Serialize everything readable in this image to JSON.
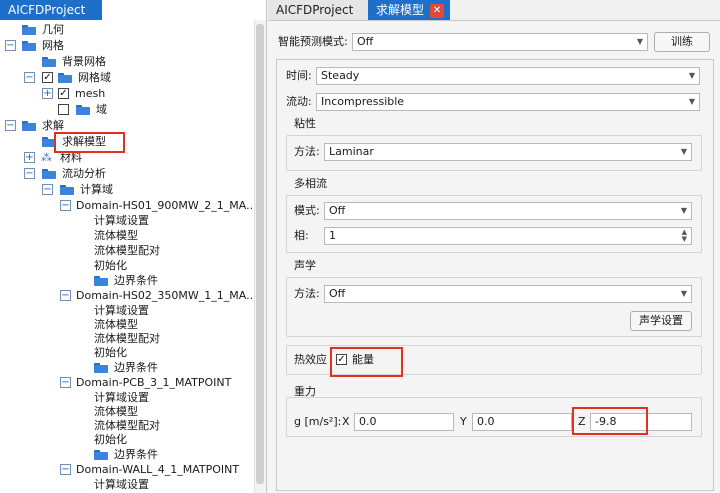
{
  "left_tab": {
    "label": "AICFDProject"
  },
  "tree": {
    "items": [
      {
        "label": "几何"
      },
      {
        "label": "网格"
      },
      {
        "label": "背景网格"
      },
      {
        "label": "网格域"
      },
      {
        "label": "mesh"
      },
      {
        "label": "域"
      },
      {
        "label": "求解"
      },
      {
        "label": "求解模型"
      },
      {
        "label": "材料"
      },
      {
        "label": "流动分析"
      },
      {
        "label": "计算域"
      },
      {
        "label": "Domain-HS01_900MW_2_1_MA..."
      },
      {
        "label": "计算域设置"
      },
      {
        "label": "流体模型"
      },
      {
        "label": "流体模型配对"
      },
      {
        "label": "初始化"
      },
      {
        "label": "边界条件"
      },
      {
        "label": "Domain-HS02_350MW_1_1_MA..."
      },
      {
        "label": "计算域设置"
      },
      {
        "label": "流体模型"
      },
      {
        "label": "流体模型配对"
      },
      {
        "label": "初始化"
      },
      {
        "label": "边界条件"
      },
      {
        "label": "Domain-PCB_3_1_MATPOINT"
      },
      {
        "label": "计算域设置"
      },
      {
        "label": "流体模型"
      },
      {
        "label": "流体模型配对"
      },
      {
        "label": "初始化"
      },
      {
        "label": "边界条件"
      },
      {
        "label": "Domain-WALL_4_1_MATPOINT"
      },
      {
        "label": "计算域设置"
      }
    ]
  },
  "right_tabs": [
    {
      "label": "AICFDProject"
    },
    {
      "label": "求解模型",
      "close": "✕"
    }
  ],
  "form": {
    "smart_mode": {
      "label": "智能预测模式:",
      "value": "Off"
    },
    "train_button": "训练",
    "time": {
      "label": "时间:",
      "value": "Steady"
    },
    "flow": {
      "label": "流动:",
      "value": "Incompressible"
    },
    "viscosity": {
      "title": "粘性",
      "method_label": "方法:",
      "method_value": "Laminar"
    },
    "multiphase": {
      "title": "多相流",
      "model_label": "模式:",
      "model_value": "Off",
      "phase_label": "相:",
      "phase_value": "1"
    },
    "acoustics": {
      "title": "声学",
      "method_label": "方法:",
      "method_value": "Off",
      "settings_button": "声学设置"
    },
    "thermal": {
      "label": "热效应",
      "energy_label": "能量",
      "energy_checked": "✓"
    },
    "gravity": {
      "title": "重力",
      "unit_label": "g [m/s²]:",
      "x_label": "X",
      "x_value": "0.0",
      "y_label": "Y",
      "y_value": "0.0",
      "z_label": "Z",
      "z_value": "-9.8"
    }
  },
  "colors": {
    "accent": "#1e6fc9",
    "highlight": "#e0301e"
  }
}
